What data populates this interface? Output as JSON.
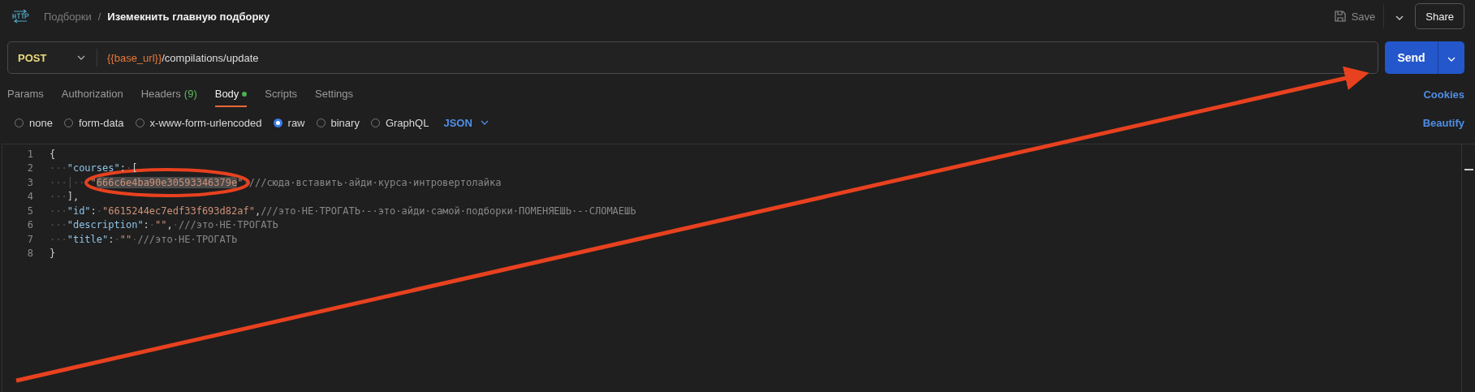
{
  "breadcrumb": {
    "parent": "Подборки",
    "separator": "/",
    "current": "Иземекнить главную подборку"
  },
  "header_actions": {
    "save": "Save",
    "share": "Share"
  },
  "request": {
    "method": "POST",
    "url_variable": "{{base_url}}",
    "url_path": "/compilations/update",
    "send": "Send"
  },
  "tabs": [
    {
      "label": "Params",
      "selected": false
    },
    {
      "label": "Authorization",
      "selected": false
    },
    {
      "label": "Headers",
      "count": "(9)",
      "selected": false
    },
    {
      "label": "Body",
      "selected": true,
      "dot": true
    },
    {
      "label": "Scripts",
      "selected": false
    },
    {
      "label": "Settings",
      "selected": false
    }
  ],
  "cookies_link": "Cookies",
  "body_types": [
    {
      "label": "none",
      "selected": false
    },
    {
      "label": "form-data",
      "selected": false
    },
    {
      "label": "x-www-form-urlencoded",
      "selected": false
    },
    {
      "label": "raw",
      "selected": true
    },
    {
      "label": "binary",
      "selected": false
    },
    {
      "label": "GraphQL",
      "selected": false
    }
  ],
  "raw_format": "JSON",
  "beautify_link": "Beautify",
  "editor": {
    "lines": [
      {
        "number": "1",
        "tokens": [
          {
            "kind": "punct",
            "text": "{"
          }
        ]
      },
      {
        "number": "2",
        "tokens": [
          {
            "kind": "ws",
            "text": "···"
          },
          {
            "kind": "key",
            "text": "\"courses\""
          },
          {
            "kind": "punct",
            "text": ":"
          },
          {
            "kind": "ws",
            "text": "·"
          },
          {
            "kind": "punct",
            "text": "["
          }
        ]
      },
      {
        "number": "3",
        "tokens": [
          {
            "kind": "ws",
            "text": "···"
          },
          {
            "kind": "guide",
            "text": "│"
          },
          {
            "kind": "ws",
            "text": "···"
          },
          {
            "kind": "string",
            "text": "\""
          },
          {
            "kind": "selected",
            "text": "666c6e4ba90e30593346379e"
          },
          {
            "kind": "string",
            "text": "\""
          },
          {
            "kind": "ws",
            "text": "·"
          },
          {
            "kind": "comment",
            "text": "///сюда·вставить·айди·курса·интровертолайка"
          }
        ]
      },
      {
        "number": "4",
        "tokens": [
          {
            "kind": "ws",
            "text": "···"
          },
          {
            "kind": "punct",
            "text": "],"
          }
        ]
      },
      {
        "number": "5",
        "tokens": [
          {
            "kind": "ws",
            "text": "···"
          },
          {
            "kind": "key",
            "text": "\"id\""
          },
          {
            "kind": "punct",
            "text": ":"
          },
          {
            "kind": "ws",
            "text": "·"
          },
          {
            "kind": "string",
            "text": "\"6615244ec7edf33f693d82af\""
          },
          {
            "kind": "punct",
            "text": ","
          },
          {
            "kind": "comment",
            "text": "///это·НЕ·ТРОГАТЬ·-·это·айди·самой·подборки·ПОМЕНЯЕШЬ·-·СЛОМАЕШЬ"
          }
        ]
      },
      {
        "number": "6",
        "tokens": [
          {
            "kind": "ws",
            "text": "···"
          },
          {
            "kind": "key",
            "text": "\"description\""
          },
          {
            "kind": "punct",
            "text": ":"
          },
          {
            "kind": "ws",
            "text": "·"
          },
          {
            "kind": "string",
            "text": "\"\""
          },
          {
            "kind": "punct",
            "text": ","
          },
          {
            "kind": "ws",
            "text": "·"
          },
          {
            "kind": "comment",
            "text": "///это·НЕ·ТРОГАТЬ"
          }
        ]
      },
      {
        "number": "7",
        "tokens": [
          {
            "kind": "ws",
            "text": "···"
          },
          {
            "kind": "key",
            "text": "\"title\""
          },
          {
            "kind": "punct",
            "text": ":"
          },
          {
            "kind": "ws",
            "text": "·"
          },
          {
            "kind": "string",
            "text": "\"\""
          },
          {
            "kind": "ws",
            "text": "·"
          },
          {
            "kind": "comment",
            "text": "///это·НЕ·ТРОГАТЬ"
          }
        ]
      },
      {
        "number": "8",
        "tokens": [
          {
            "kind": "punct",
            "text": "}"
          }
        ]
      }
    ]
  }
}
